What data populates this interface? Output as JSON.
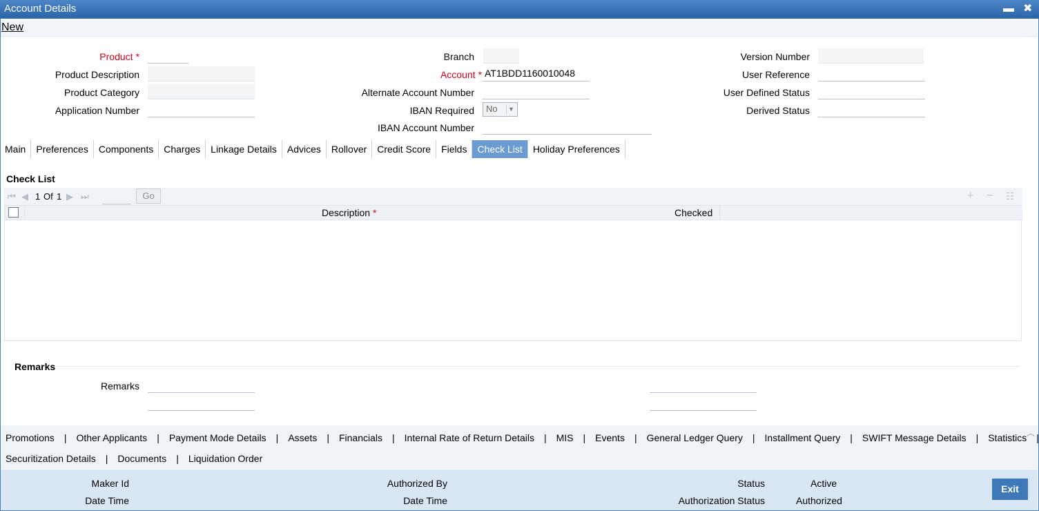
{
  "window": {
    "title": "Account Details",
    "minimize": "▬",
    "close": "✖"
  },
  "menu": {
    "new": "New"
  },
  "header": {
    "product_label": "Product",
    "product_value": "",
    "product_description_label": "Product Description",
    "product_category_label": "Product Category",
    "application_number_label": "Application Number",
    "branch_label": "Branch",
    "account_label": "Account",
    "account_value": "AT1BDD1160010048",
    "alternate_account_label": "Alternate Account Number",
    "iban_required_label": "IBAN Required",
    "iban_required_value": "No",
    "iban_account_label": "IBAN Account Number",
    "version_number_label": "Version Number",
    "user_reference_label": "User Reference",
    "user_defined_status_label": "User Defined Status",
    "derived_status_label": "Derived Status"
  },
  "tabs": [
    "Main",
    "Preferences",
    "Components",
    "Charges",
    "Linkage Details",
    "Advices",
    "Rollover",
    "Credit Score",
    "Fields",
    "Check List",
    "Holiday Preferences"
  ],
  "active_tab": "Check List",
  "checklist": {
    "title": "Check List",
    "pager": {
      "current": "1",
      "of": "Of",
      "total": "1",
      "go": "Go"
    },
    "columns": {
      "description": "Description",
      "checked": "Checked"
    }
  },
  "remarks": {
    "section_title": "Remarks",
    "label": "Remarks"
  },
  "links_row1": [
    "Promotions",
    "Other Applicants",
    "Payment Mode Details",
    "Assets",
    "Financials",
    "Internal Rate of Return Details",
    "MIS",
    "Events",
    "General Ledger Query",
    "Installment Query",
    "SWIFT Message Details",
    "Statistics"
  ],
  "links_row2": [
    "Securitization Details",
    "Documents",
    "Liquidation Order"
  ],
  "footer": {
    "maker_id_label": "Maker Id",
    "date_time_label": "Date Time",
    "authorized_by_label": "Authorized By",
    "date_time_label_2": "Date Time",
    "status_label": "Status",
    "status_value": "Active",
    "authorization_status_label": "Authorization Status",
    "authorization_status_value": "Authorized",
    "exit": "Exit"
  },
  "colors": {
    "title_bar": "#2a63a8",
    "active_tab": "#6c9bd2",
    "required": "#d0021b",
    "footer_bg": "#d9e6f3",
    "exit_button": "#3f78b8"
  }
}
